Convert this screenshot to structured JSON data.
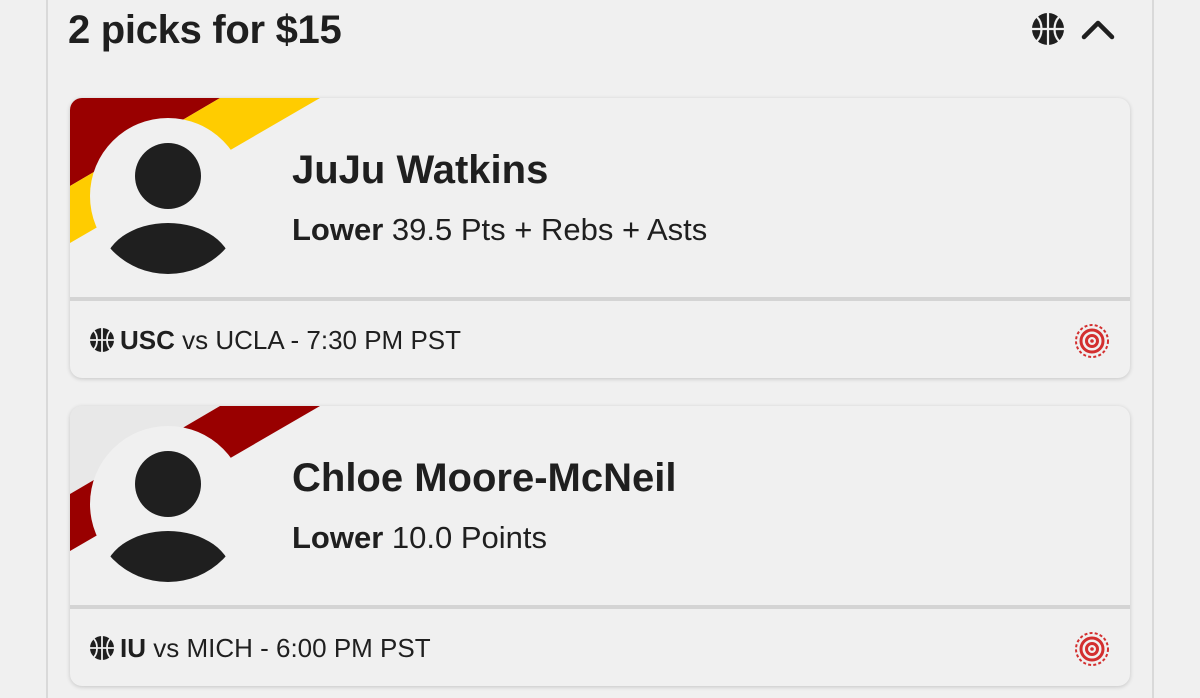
{
  "header": {
    "title": "2 picks for $15",
    "sport_icon": "basketball-icon",
    "collapse_icon": "chevron-up-icon"
  },
  "colors": {
    "usc_primary": "#990000",
    "usc_secondary": "#FFCC00",
    "iu_primary": "#990000",
    "target_red": "#d32f2f",
    "avatar_dark": "#1f1f1f"
  },
  "picks": [
    {
      "player": "JuJu Watkins",
      "direction": "Lower",
      "line": "39.5 Pts + Rebs + Asts",
      "team": "USC",
      "vs_text": "vs UCLA - 7:30 PM PST",
      "avatar_icon": "person-silhouette-icon",
      "status_icon": "target-icon"
    },
    {
      "player": "Chloe Moore-McNeil",
      "direction": "Lower",
      "line": "10.0 Points",
      "team": "IU",
      "vs_text": "vs MICH - 6:00 PM PST",
      "avatar_icon": "person-silhouette-icon",
      "status_icon": "target-icon"
    }
  ]
}
